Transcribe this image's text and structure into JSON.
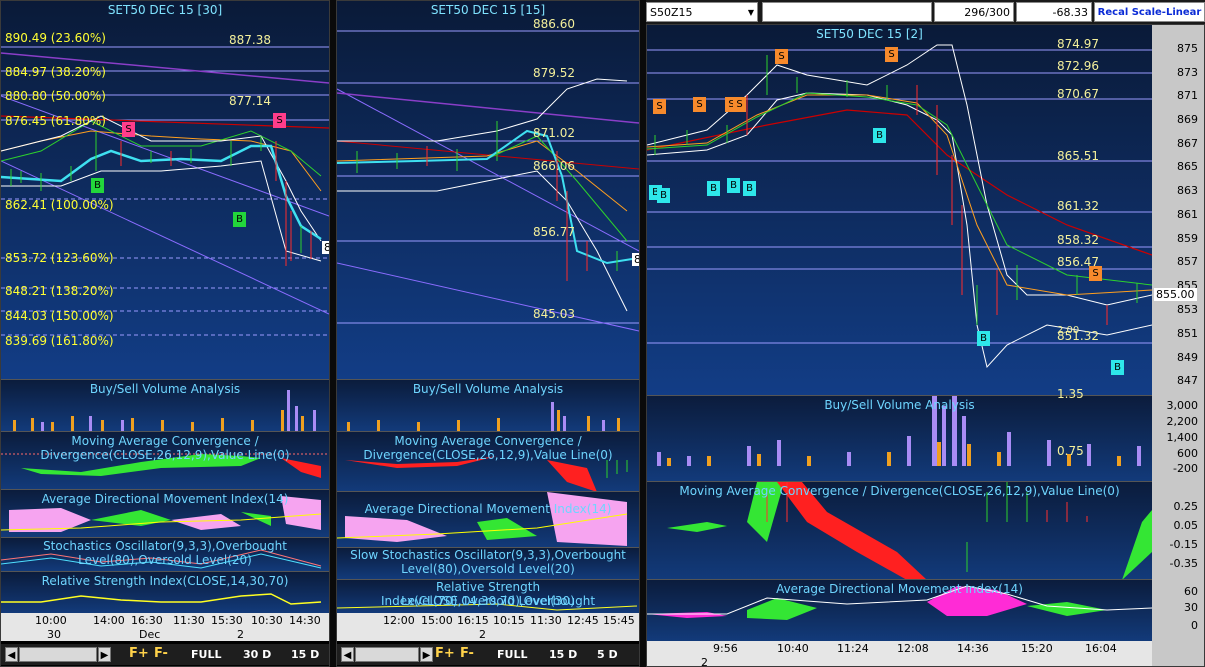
{
  "left_chart": {
    "title": "SET50 DEC 15   [30]",
    "fib_levels": [
      "890.49 (23.60%)",
      "884.97 (38.20%)",
      "880.80 (50.00%)",
      "876.45 (61.80%)",
      "862.41 (100.00%)",
      "853.72 (123.60%)",
      "848.21 (138.20%)",
      "844.03 (150.00%)",
      "839.69 (161.80%)"
    ],
    "price_labels": [
      "887.38",
      "877.14"
    ],
    "markers": [
      "B",
      "B",
      "S",
      "S"
    ],
    "sub_titles": {
      "volume": "Buy/Sell Volume Analysis",
      "macd_1": "Moving Average Convergence /",
      "macd_2": "Divergence(CLOSE,26,12,9),Value Line(0)",
      "adx": "Average Directional Movement Index(14)",
      "stoch_1": "Stochastics Oscillator(9,3,3),Overbought",
      "stoch_2": "Level(80),Oversold Level(20)",
      "rsi": "Relative Strength Index(CLOSE,14,30,70)"
    },
    "x_labels": [
      "10:00",
      "14:00",
      "16:30",
      "11:30",
      "15:30",
      "10:30",
      "14:30"
    ],
    "date_labels": [
      "30",
      "Dec",
      "2"
    ],
    "nav": {
      "f_plus": "F+",
      "f_minus": "F-",
      "full": "FULL",
      "range_1": "30 D",
      "range_2": "15 D"
    },
    "edge_label": "8"
  },
  "mid_chart": {
    "title": "SET50 DEC 15   [15]",
    "price_labels": [
      "886.60",
      "879.52",
      "871.02",
      "866.06",
      "856.77",
      "845.03"
    ],
    "sub_titles": {
      "volume": "Buy/Sell Volume Analysis",
      "macd_1": "Moving Average Convergence /",
      "macd_2": "Divergence(CLOSE,26,12,9),Value Line(0)",
      "adx": "Average Directional Movement Index(14)",
      "stoch_1": "Slow Stochastics Oscillator(9,3,3),Overbought",
      "stoch_2": "Level(80),Oversold Level(20)",
      "rsi_1": "Relative Strength Index(CLOSE,14,30,70),Overbought",
      "rsi_2": "Level(70),Oversold Level(30)"
    },
    "x_labels": [
      "12:00",
      "15:00",
      "16:15",
      "10:15",
      "11:30",
      "12:45",
      "15:45"
    ],
    "date_labels": [
      "2"
    ],
    "nav": {
      "f_plus": "F+",
      "f_minus": "F-",
      "full": "FULL",
      "range_1": "15 D",
      "range_2": "5 D"
    },
    "edge_label": "8"
  },
  "right_chart": {
    "symbol": "S50Z15",
    "counter": "296/300",
    "change": "-68.33",
    "scale_mode": "Recal Scale-Linear",
    "title": "SET50 DEC 15   [2]",
    "price_labels": [
      "874.97",
      "872.96",
      "870.67",
      "865.51",
      "861.32",
      "858.32",
      "856.47",
      "851.32",
      "1.35",
      "0.75"
    ],
    "overlay_label": "2.00",
    "current_price": "855.00",
    "y_ticks": [
      "875",
      "873",
      "871",
      "869",
      "867",
      "865",
      "863",
      "861",
      "859",
      "857",
      "855",
      "853",
      "851",
      "849",
      "847"
    ],
    "vol_ticks": [
      "3,000",
      "2,200",
      "1,400",
      "600",
      "-200"
    ],
    "macd_ticks": [
      "0.25",
      "0.05",
      "-0.15",
      "-0.35"
    ],
    "adx_ticks": [
      "60",
      "30",
      "0"
    ],
    "sub_titles": {
      "volume": "Buy/Sell Volume Analysis",
      "macd": "Moving Average Convergence / Divergence(CLOSE,26,12,9),Value Line(0)",
      "adx": "Average Directional Movement Index(14)"
    },
    "x_labels": [
      "9:56",
      "10:40",
      "11:24",
      "12:08",
      "14:36",
      "15:20",
      "16:04"
    ],
    "date_labels": [
      "2"
    ],
    "markers_sell": [
      "S",
      "S",
      "S",
      "S",
      "S",
      "S",
      "S"
    ],
    "markers_cover": [
      "B",
      "B",
      "B",
      "B",
      "B",
      "B",
      "B",
      "B",
      "B"
    ]
  }
}
